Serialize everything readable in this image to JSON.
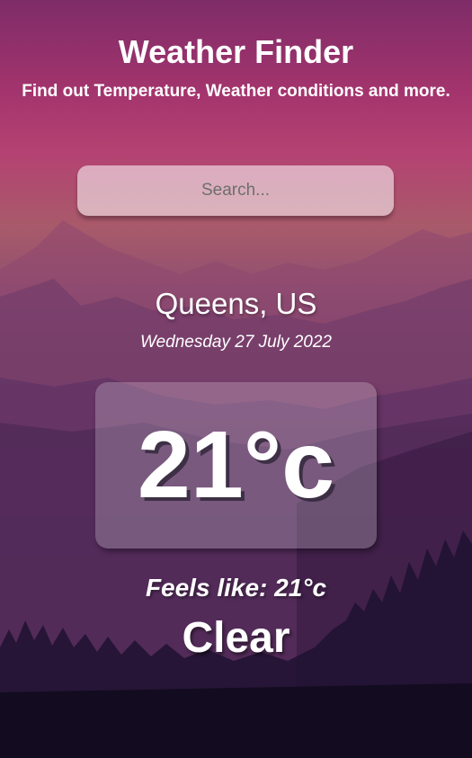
{
  "header": {
    "title": "Weather Finder",
    "subtitle": "Find out Temperature, Weather conditions and more."
  },
  "search": {
    "value": "",
    "placeholder": "Search..."
  },
  "weather": {
    "location": "Queens, US",
    "date": "Wednesday 27 July 2022",
    "temperature": "21°c",
    "feels_like": "Feels like: 21°c",
    "condition": "Clear"
  },
  "colors": {
    "text": "#ffffff",
    "sky_top": "#7e2c68",
    "sky_mid": "#b44272",
    "ground_bottom": "#130c20"
  }
}
